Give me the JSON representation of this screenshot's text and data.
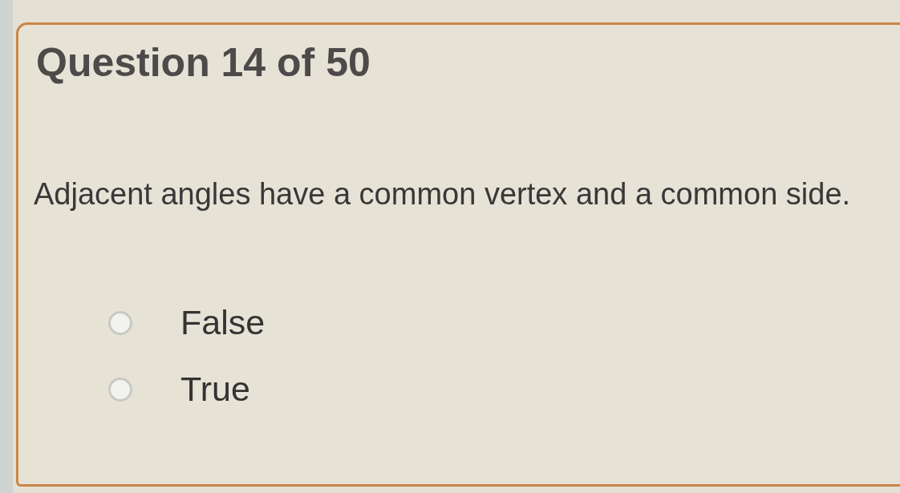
{
  "question": {
    "header": "Question 14 of 50",
    "prompt": "Adjacent angles have a common vertex and a common side.",
    "options": [
      {
        "label": "False",
        "selected": false
      },
      {
        "label": "True",
        "selected": false
      }
    ]
  }
}
